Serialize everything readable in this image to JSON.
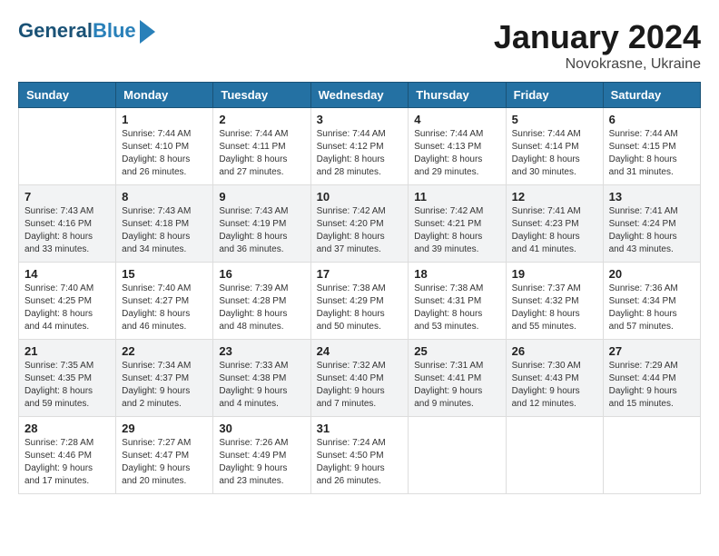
{
  "logo": {
    "line1": "General",
    "line2": "Blue"
  },
  "title": "January 2024",
  "location": "Novokrasne, Ukraine",
  "days_of_week": [
    "Sunday",
    "Monday",
    "Tuesday",
    "Wednesday",
    "Thursday",
    "Friday",
    "Saturday"
  ],
  "weeks": [
    [
      {
        "day": "",
        "info": ""
      },
      {
        "day": "1",
        "info": "Sunrise: 7:44 AM\nSunset: 4:10 PM\nDaylight: 8 hours\nand 26 minutes."
      },
      {
        "day": "2",
        "info": "Sunrise: 7:44 AM\nSunset: 4:11 PM\nDaylight: 8 hours\nand 27 minutes."
      },
      {
        "day": "3",
        "info": "Sunrise: 7:44 AM\nSunset: 4:12 PM\nDaylight: 8 hours\nand 28 minutes."
      },
      {
        "day": "4",
        "info": "Sunrise: 7:44 AM\nSunset: 4:13 PM\nDaylight: 8 hours\nand 29 minutes."
      },
      {
        "day": "5",
        "info": "Sunrise: 7:44 AM\nSunset: 4:14 PM\nDaylight: 8 hours\nand 30 minutes."
      },
      {
        "day": "6",
        "info": "Sunrise: 7:44 AM\nSunset: 4:15 PM\nDaylight: 8 hours\nand 31 minutes."
      }
    ],
    [
      {
        "day": "7",
        "info": "Sunrise: 7:43 AM\nSunset: 4:16 PM\nDaylight: 8 hours\nand 33 minutes."
      },
      {
        "day": "8",
        "info": "Sunrise: 7:43 AM\nSunset: 4:18 PM\nDaylight: 8 hours\nand 34 minutes."
      },
      {
        "day": "9",
        "info": "Sunrise: 7:43 AM\nSunset: 4:19 PM\nDaylight: 8 hours\nand 36 minutes."
      },
      {
        "day": "10",
        "info": "Sunrise: 7:42 AM\nSunset: 4:20 PM\nDaylight: 8 hours\nand 37 minutes."
      },
      {
        "day": "11",
        "info": "Sunrise: 7:42 AM\nSunset: 4:21 PM\nDaylight: 8 hours\nand 39 minutes."
      },
      {
        "day": "12",
        "info": "Sunrise: 7:41 AM\nSunset: 4:23 PM\nDaylight: 8 hours\nand 41 minutes."
      },
      {
        "day": "13",
        "info": "Sunrise: 7:41 AM\nSunset: 4:24 PM\nDaylight: 8 hours\nand 43 minutes."
      }
    ],
    [
      {
        "day": "14",
        "info": "Sunrise: 7:40 AM\nSunset: 4:25 PM\nDaylight: 8 hours\nand 44 minutes."
      },
      {
        "day": "15",
        "info": "Sunrise: 7:40 AM\nSunset: 4:27 PM\nDaylight: 8 hours\nand 46 minutes."
      },
      {
        "day": "16",
        "info": "Sunrise: 7:39 AM\nSunset: 4:28 PM\nDaylight: 8 hours\nand 48 minutes."
      },
      {
        "day": "17",
        "info": "Sunrise: 7:38 AM\nSunset: 4:29 PM\nDaylight: 8 hours\nand 50 minutes."
      },
      {
        "day": "18",
        "info": "Sunrise: 7:38 AM\nSunset: 4:31 PM\nDaylight: 8 hours\nand 53 minutes."
      },
      {
        "day": "19",
        "info": "Sunrise: 7:37 AM\nSunset: 4:32 PM\nDaylight: 8 hours\nand 55 minutes."
      },
      {
        "day": "20",
        "info": "Sunrise: 7:36 AM\nSunset: 4:34 PM\nDaylight: 8 hours\nand 57 minutes."
      }
    ],
    [
      {
        "day": "21",
        "info": "Sunrise: 7:35 AM\nSunset: 4:35 PM\nDaylight: 8 hours\nand 59 minutes."
      },
      {
        "day": "22",
        "info": "Sunrise: 7:34 AM\nSunset: 4:37 PM\nDaylight: 9 hours\nand 2 minutes."
      },
      {
        "day": "23",
        "info": "Sunrise: 7:33 AM\nSunset: 4:38 PM\nDaylight: 9 hours\nand 4 minutes."
      },
      {
        "day": "24",
        "info": "Sunrise: 7:32 AM\nSunset: 4:40 PM\nDaylight: 9 hours\nand 7 minutes."
      },
      {
        "day": "25",
        "info": "Sunrise: 7:31 AM\nSunset: 4:41 PM\nDaylight: 9 hours\nand 9 minutes."
      },
      {
        "day": "26",
        "info": "Sunrise: 7:30 AM\nSunset: 4:43 PM\nDaylight: 9 hours\nand 12 minutes."
      },
      {
        "day": "27",
        "info": "Sunrise: 7:29 AM\nSunset: 4:44 PM\nDaylight: 9 hours\nand 15 minutes."
      }
    ],
    [
      {
        "day": "28",
        "info": "Sunrise: 7:28 AM\nSunset: 4:46 PM\nDaylight: 9 hours\nand 17 minutes."
      },
      {
        "day": "29",
        "info": "Sunrise: 7:27 AM\nSunset: 4:47 PM\nDaylight: 9 hours\nand 20 minutes."
      },
      {
        "day": "30",
        "info": "Sunrise: 7:26 AM\nSunset: 4:49 PM\nDaylight: 9 hours\nand 23 minutes."
      },
      {
        "day": "31",
        "info": "Sunrise: 7:24 AM\nSunset: 4:50 PM\nDaylight: 9 hours\nand 26 minutes."
      },
      {
        "day": "",
        "info": ""
      },
      {
        "day": "",
        "info": ""
      },
      {
        "day": "",
        "info": ""
      }
    ]
  ]
}
